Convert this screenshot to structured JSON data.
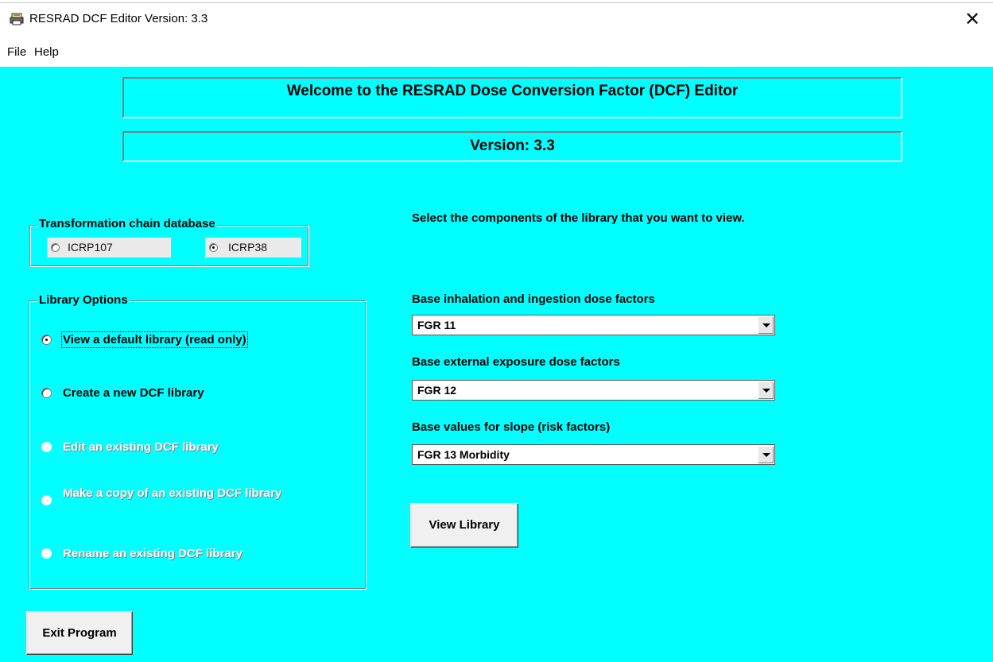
{
  "window": {
    "title": "RESRAD DCF Editor Version: 3.3",
    "icon": "printer-app-icon",
    "close_glyph": "✕"
  },
  "menu": {
    "items": [
      "File",
      "Help"
    ]
  },
  "colors": {
    "background": "#00ffff",
    "accent": "#00ffff"
  },
  "banner": {
    "welcome": "Welcome to the RESRAD Dose Conversion Factor (DCF) Editor",
    "version": "Version: 3.3"
  },
  "transformation_chain": {
    "label": "Transformation chain database",
    "options": [
      {
        "label": "ICRP107",
        "selected": false
      },
      {
        "label": "ICRP38",
        "selected": true
      }
    ]
  },
  "library_options": {
    "label": "Library Options",
    "options": [
      {
        "label": "View a default library (read only)",
        "selected": true,
        "enabled": true
      },
      {
        "label": "Create a new DCF library",
        "selected": false,
        "enabled": true
      },
      {
        "label": "Edit an existing DCF library",
        "selected": false,
        "enabled": false
      },
      {
        "label": "Make a copy of an existing DCF library",
        "selected": false,
        "enabled": false
      },
      {
        "label": "Rename an existing DCF library",
        "selected": false,
        "enabled": false
      }
    ]
  },
  "components": {
    "instruction": "Select the components of the library that you want to view.",
    "inhalation": {
      "label": "Base inhalation and ingestion dose factors",
      "value": "FGR 11"
    },
    "external": {
      "label": "Base external exposure dose factors",
      "value": "FGR 12"
    },
    "slope": {
      "label": "Base values for slope (risk factors)",
      "value": "FGR 13 Morbidity"
    }
  },
  "buttons": {
    "view_library": "View Library",
    "exit_program": "Exit Program"
  }
}
